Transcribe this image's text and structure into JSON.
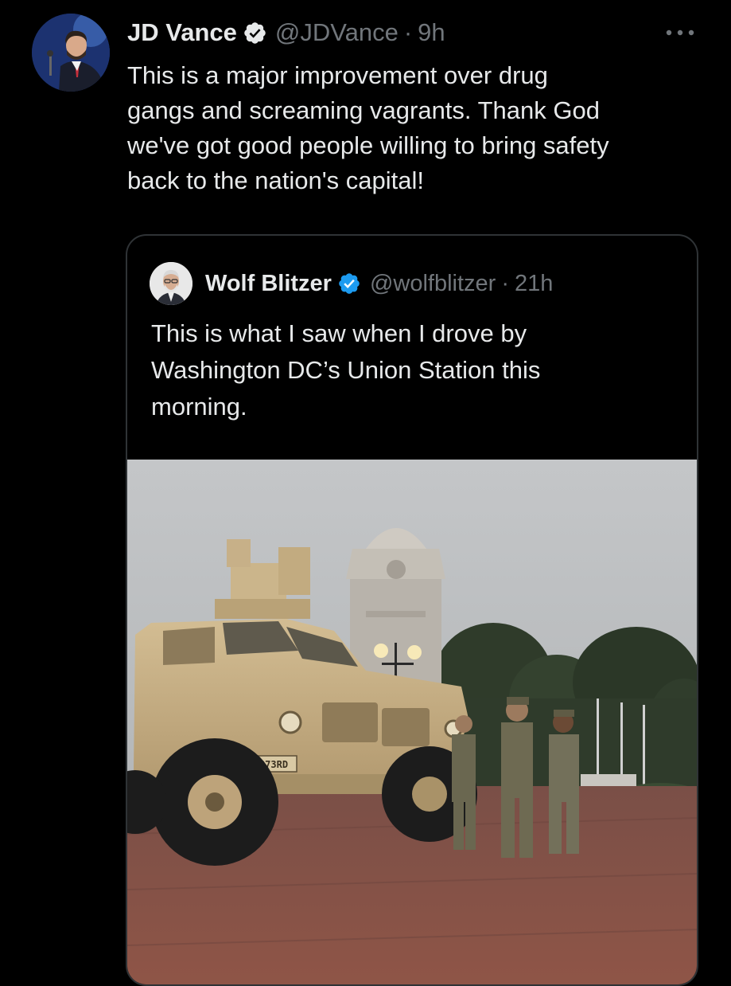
{
  "tweet": {
    "author": {
      "name": "JD Vance",
      "handle": "@JDVance",
      "avatar_icon": "profile-photo-avatar",
      "verified_icon": "verified-badge-icon"
    },
    "separator": "·",
    "time": "9h",
    "more_icon": "more-options-icon",
    "text_lines": [
      "This is a major improvement over drug",
      "gangs and screaming vagrants. Thank God",
      "we've got good people willing to bring safety",
      "back to the nation's capital!"
    ]
  },
  "quoted_tweet": {
    "author": {
      "name": "Wolf Blitzer",
      "handle": "@wolfblitzer",
      "avatar_icon": "profile-photo-avatar",
      "verified_icon": "verified-badge-icon"
    },
    "separator": "·",
    "time": "21h",
    "text_lines": [
      "This is what I saw when I drove by",
      "Washington DC’s Union Station this",
      "morning."
    ],
    "media": {
      "type": "photo",
      "vehicle_marking": "273RD"
    }
  },
  "colors": {
    "background": "#000000",
    "text_primary": "#e7e9ea",
    "text_secondary": "#71767b",
    "verified_blue": "#1d9bf0",
    "border": "#2f3336"
  }
}
